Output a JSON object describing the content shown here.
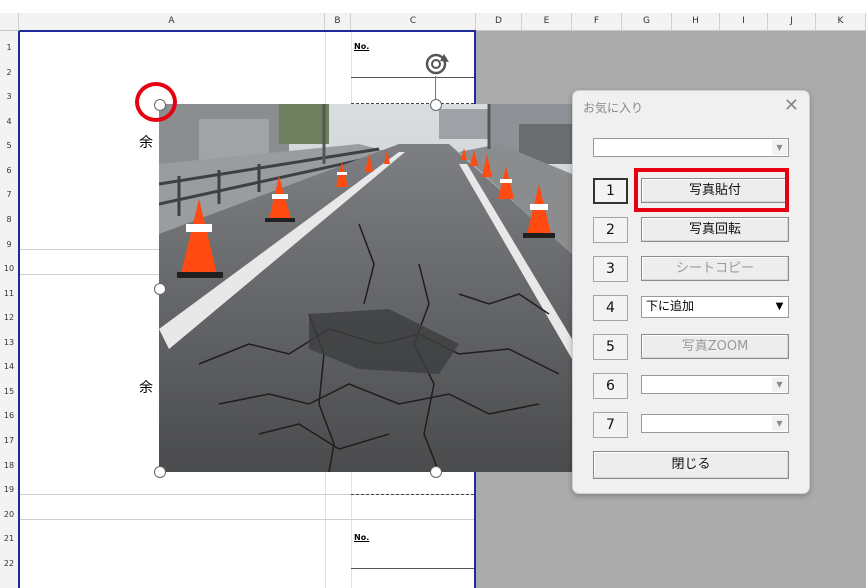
{
  "columns": [
    "A",
    "B",
    "C",
    "D",
    "E",
    "F",
    "G",
    "H",
    "I",
    "J",
    "K"
  ],
  "rows": [
    "1",
    "2",
    "3",
    "4",
    "5",
    "6",
    "7",
    "8",
    "9",
    "10",
    "11",
    "12",
    "13",
    "14",
    "15",
    "16",
    "17",
    "18",
    "19",
    "20",
    "21",
    "22"
  ],
  "sheet_text": {
    "yo_1": "余",
    "yo_2": "余",
    "no_1": "No.",
    "no_2": "No."
  },
  "photo": {
    "description_icon": "road-photo"
  },
  "dialog": {
    "title": "お気に入り",
    "close_glyph": "✕",
    "top_combo_value": "",
    "rows": [
      {
        "num": "1",
        "label": "写真貼付",
        "enabled": true
      },
      {
        "num": "2",
        "label": "写真回転",
        "enabled": true
      },
      {
        "num": "3",
        "label": "シートコピー",
        "enabled": false
      },
      {
        "num": "4",
        "label": "下に追加",
        "type": "combo"
      },
      {
        "num": "5",
        "label": "写真ZOOM",
        "enabled": false
      },
      {
        "num": "6",
        "label": "",
        "type": "combo"
      },
      {
        "num": "7",
        "label": "",
        "type": "combo"
      }
    ],
    "close_button": "閉じる"
  },
  "colors": {
    "highlight_red": "#e60012",
    "border_blue": "#1f2b9b"
  }
}
